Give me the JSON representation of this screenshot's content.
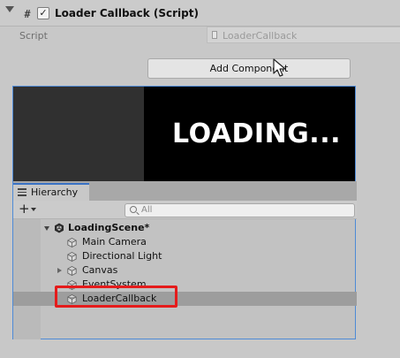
{
  "inspector": {
    "component_title": "Loader Callback (Script)",
    "enabled_mark": "✓",
    "script_glyph": "#",
    "script_label": "Script",
    "script_value": "LoaderCallback",
    "add_component_label": "Add Component"
  },
  "game_view": {
    "loading_text": "LOADING..."
  },
  "hierarchy": {
    "tab_label": "Hierarchy",
    "add_glyph": "+",
    "search_placeholder": "All",
    "scene_name": "LoadingScene*",
    "items": [
      {
        "label": "Main Camera",
        "foldout": false
      },
      {
        "label": "Directional Light",
        "foldout": false
      },
      {
        "label": "Canvas",
        "foldout": true
      },
      {
        "label": "EventSystem",
        "foldout": false
      },
      {
        "label": "LoaderCallback",
        "foldout": false,
        "selected": true
      }
    ]
  },
  "colors": {
    "highlight_border": "#e51b1b",
    "panel_focus_border": "#4e8ad6",
    "selection_bg": "#9d9d9d"
  }
}
